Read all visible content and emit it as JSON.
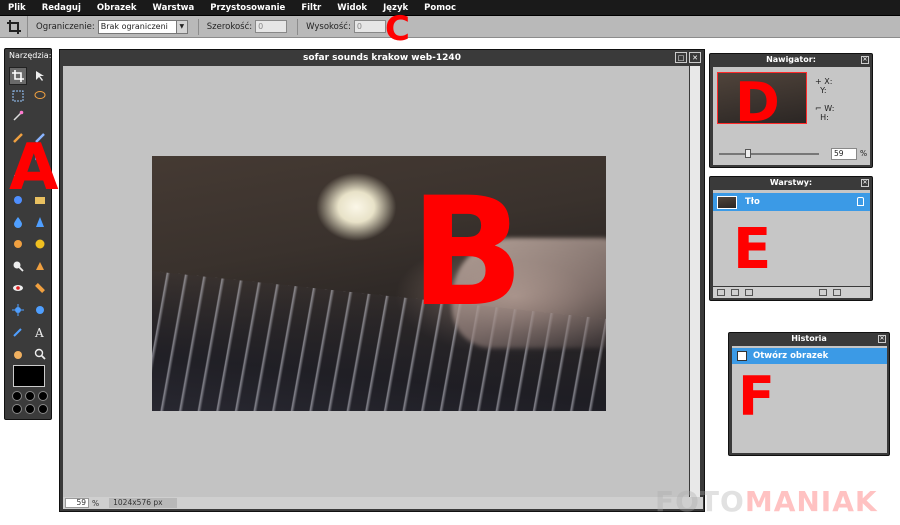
{
  "menu": [
    "Plik",
    "Redaguj",
    "Obrazek",
    "Warstwa",
    "Przystosowanie",
    "Filtr",
    "Widok",
    "Język",
    "Pomoc"
  ],
  "options": {
    "constraint_label": "Ograniczenie:",
    "constraint_value": "Brak ograniczeni",
    "width_label": "Szerokość:",
    "width_value": "0",
    "height_label": "Wysokość:",
    "height_value": "0"
  },
  "tools": {
    "title": "Narzędzia:"
  },
  "document": {
    "title": "sofar sounds krakow web-1240",
    "zoom": "59",
    "zoom_unit": "%",
    "size": "1024x576 px"
  },
  "navigator": {
    "title": "Nawigator:",
    "x_label": "X:",
    "y_label": "Y:",
    "w_label": "W:",
    "h_label": "H:",
    "zoom": "59",
    "zoom_unit": "%"
  },
  "layers": {
    "title": "Warstwy:",
    "items": [
      {
        "name": "Tło"
      }
    ]
  },
  "history": {
    "title": "Historia",
    "items": [
      {
        "name": "Otwórz obrazek"
      }
    ]
  },
  "annotations": {
    "a": "A",
    "b": "B",
    "c": "C",
    "d": "D",
    "e": "E",
    "f": "F"
  },
  "watermark": {
    "part1": "FOTO",
    "part2": "MANIAK"
  },
  "colors": {
    "accent": "#3b9ae6",
    "annotation": "#ff0000",
    "panel": "#3a3a3a"
  }
}
